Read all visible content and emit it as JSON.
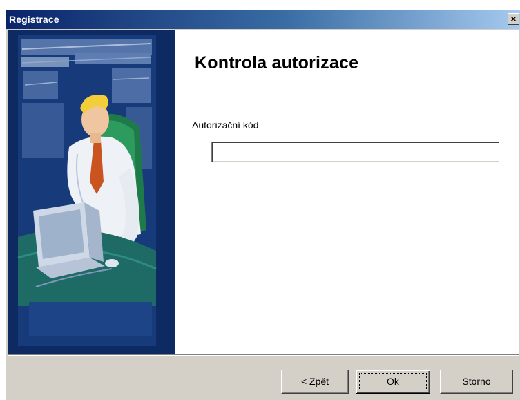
{
  "window": {
    "title": "Registrace",
    "close_glyph": "×"
  },
  "page": {
    "heading": "Kontrola autorizace",
    "field_label": "Autorizační kód",
    "auth_code_value": "",
    "auth_code_placeholder": ""
  },
  "buttons": {
    "back": "< Zpět",
    "ok": "Ok",
    "cancel": "Storno"
  },
  "illustration": {
    "subject": "man-at-computer"
  },
  "colors": {
    "title_start": "#0a246a",
    "title_end": "#a6caf0",
    "side_panel": "#0d2a63",
    "dialog_face": "#d4d0c8"
  }
}
